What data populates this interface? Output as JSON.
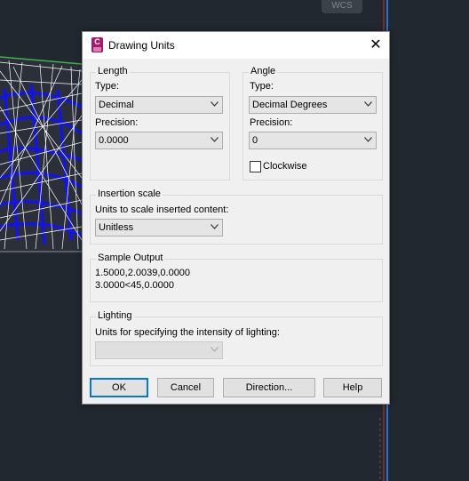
{
  "background": {
    "wcs_label": "WCS"
  },
  "dialog": {
    "title": "Drawing Units",
    "app_icon_letter": "C",
    "close_glyph": "✕",
    "length": {
      "group_label": "Length",
      "type_label": "Type:",
      "type_value": "Decimal",
      "precision_label": "Precision:",
      "precision_value": "0.0000"
    },
    "angle": {
      "group_label": "Angle",
      "type_label": "Type:",
      "type_value": "Decimal Degrees",
      "precision_label": "Precision:",
      "precision_value": "0",
      "clockwise_label": "Clockwise",
      "clockwise_checked": false
    },
    "insertion": {
      "group_label": "Insertion scale",
      "units_label": "Units to scale inserted content:",
      "units_value": "Unitless"
    },
    "sample": {
      "group_label": "Sample Output",
      "line1": "1.5000,2.0039,0.0000",
      "line2": "3.0000<45,0.0000"
    },
    "lighting": {
      "group_label": "Lighting",
      "units_label": "Units for specifying the intensity of lighting:",
      "units_value": ""
    },
    "buttons": {
      "ok": "OK",
      "cancel": "Cancel",
      "direction": "Direction...",
      "help": "Help"
    }
  },
  "colors": {
    "accent": "#0078d7",
    "app_icon": "#a8186c",
    "canvas_bg": "#212830"
  }
}
